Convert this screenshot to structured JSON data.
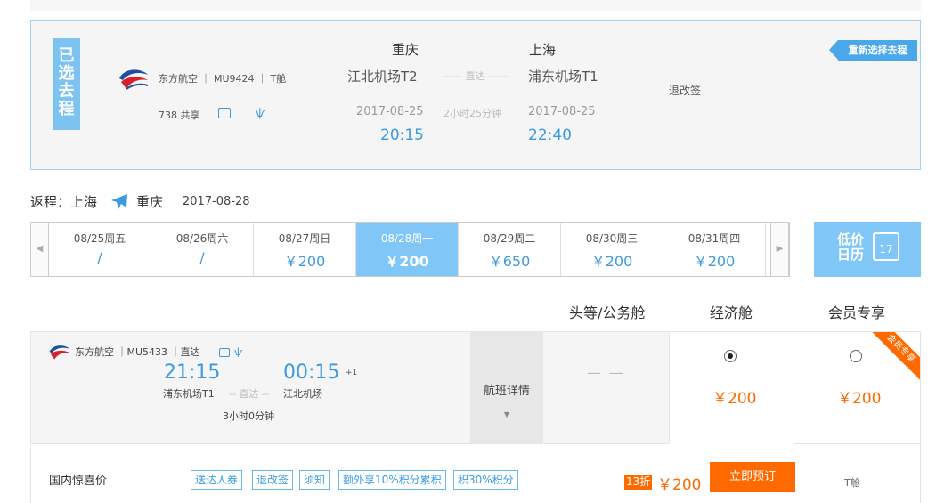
{
  "outbound": {
    "badge": [
      "已",
      "选",
      "去",
      "程"
    ],
    "airline_line": "东方航空 ｜ MU9424 ｜ T舱",
    "equip_line": "738 共享",
    "from_city": "重庆",
    "to_city": "上海",
    "from_airport": "江北机场T2",
    "to_airport": "浦东机场T1",
    "direct": "—— 直达 ——",
    "duration": "2小时25分钟",
    "from_date": "2017-08-25",
    "to_date": "2017-08-25",
    "dep_time": "20:15",
    "arr_time": "22:40",
    "refund_label": "退改签",
    "reselect_label": "重新选择去程"
  },
  "return_header": {
    "label": "返程：上海",
    "to": "重庆",
    "date": "2017-08-28"
  },
  "date_strip": {
    "prev": "◀",
    "next": "▶",
    "days": [
      {
        "date": "08/25周五",
        "price": "/"
      },
      {
        "date": "08/26周六",
        "price": "/"
      },
      {
        "date": "08/27周日",
        "price": "￥200"
      },
      {
        "date": "08/28周一",
        "price": "￥200"
      },
      {
        "date": "08/29周二",
        "price": "￥650"
      },
      {
        "date": "08/30周三",
        "price": "￥200"
      },
      {
        "date": "08/31周四",
        "price": "￥200"
      }
    ],
    "active_index": 3
  },
  "low_calendar": {
    "label": "低价日历",
    "day": "17"
  },
  "cabins": {
    "first": "头等/公务舱",
    "economy": "经济舱",
    "member": "会员专享"
  },
  "flight": {
    "airline_line": "东方航空 ｜MU5433 ｜直达 ｜",
    "dep_time": "21:15",
    "arr_time": "00:15",
    "plus_day": "+1",
    "dep_airport": "浦东机场T1",
    "arr_airport": "江北机场",
    "direct": "-- 直达 --",
    "duration": "3小时0分钟",
    "detail_label": "航班详情",
    "detail_caret": "▼",
    "first_price": "— —",
    "economy_price": "￥200",
    "member_price": "￥200",
    "member_ribbon": "会员专享"
  },
  "fare": {
    "name": "国内惊喜价",
    "tags": [
      "送达人券",
      "退改签",
      "须知",
      "额外享10%积分累积",
      "积30%积分"
    ],
    "discount": "13折",
    "price": "￥200",
    "book_label": "立即预订",
    "cabin": "T舱"
  },
  "colors": {
    "accent_blue": "#3c9be0",
    "active_day": "#80c6f6",
    "orange": "#ff6a00"
  }
}
